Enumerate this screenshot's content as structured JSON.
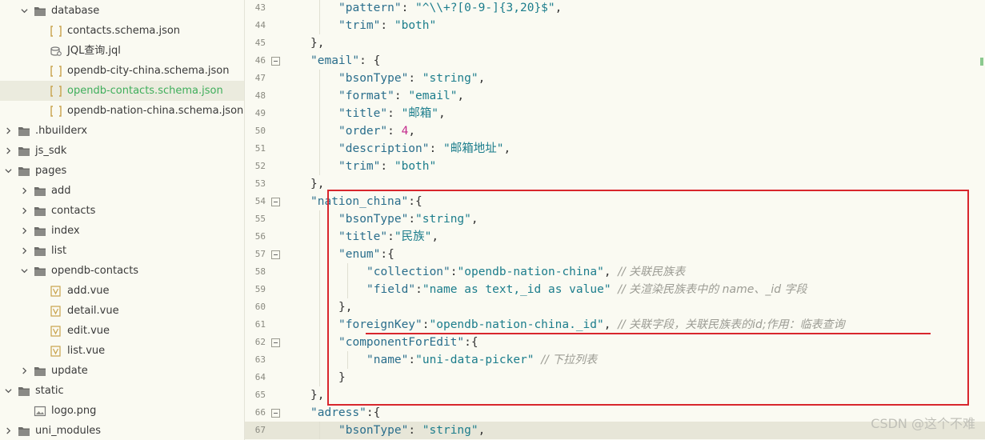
{
  "sidebar": {
    "items": [
      {
        "label": "database",
        "type": "folder",
        "indent": 1,
        "expanded": true
      },
      {
        "label": "contacts.schema.json",
        "type": "json",
        "indent": 2
      },
      {
        "label": "JQL查询.jql",
        "type": "jql",
        "indent": 2
      },
      {
        "label": "opendb-city-china.schema.json",
        "type": "json",
        "indent": 2
      },
      {
        "label": "opendb-contacts.schema.json",
        "type": "json",
        "indent": 2,
        "selected": true
      },
      {
        "label": "opendb-nation-china.schema.json",
        "type": "json",
        "indent": 2
      },
      {
        "label": ".hbuilderx",
        "type": "folder",
        "indent": 0,
        "expanded": false
      },
      {
        "label": "js_sdk",
        "type": "folder",
        "indent": 0,
        "expanded": false
      },
      {
        "label": "pages",
        "type": "folder",
        "indent": 0,
        "expanded": true
      },
      {
        "label": "add",
        "type": "folder",
        "indent": 1,
        "expanded": false
      },
      {
        "label": "contacts",
        "type": "folder",
        "indent": 1,
        "expanded": false
      },
      {
        "label": "index",
        "type": "folder",
        "indent": 1,
        "expanded": false
      },
      {
        "label": "list",
        "type": "folder",
        "indent": 1,
        "expanded": false
      },
      {
        "label": "opendb-contacts",
        "type": "folder",
        "indent": 1,
        "expanded": true
      },
      {
        "label": "add.vue",
        "type": "vue",
        "indent": 2
      },
      {
        "label": "detail.vue",
        "type": "vue",
        "indent": 2
      },
      {
        "label": "edit.vue",
        "type": "vue",
        "indent": 2
      },
      {
        "label": "list.vue",
        "type": "vue",
        "indent": 2
      },
      {
        "label": "update",
        "type": "folder",
        "indent": 1,
        "expanded": false
      },
      {
        "label": "static",
        "type": "folder",
        "indent": 0,
        "expanded": true
      },
      {
        "label": "logo.png",
        "type": "image",
        "indent": 1
      },
      {
        "label": "uni_modules",
        "type": "folder",
        "indent": 0,
        "expanded": false
      }
    ]
  },
  "editor": {
    "lines": [
      {
        "n": "43",
        "indent": 2,
        "tokens": [
          [
            "k",
            "\"pattern\""
          ],
          [
            "p",
            ": "
          ],
          [
            "s",
            "\"^\\\\+?[0-9-]{3,20}$\""
          ],
          [
            "p",
            ","
          ]
        ]
      },
      {
        "n": "44",
        "indent": 2,
        "tokens": [
          [
            "k",
            "\"trim\""
          ],
          [
            "p",
            ": "
          ],
          [
            "s",
            "\"both\""
          ]
        ]
      },
      {
        "n": "45",
        "indent": 1,
        "tokens": [
          [
            "p",
            "},"
          ]
        ]
      },
      {
        "n": "46",
        "indent": 1,
        "fold": true,
        "tokens": [
          [
            "k",
            "\"email\""
          ],
          [
            "p",
            ": {"
          ]
        ]
      },
      {
        "n": "47",
        "indent": 2,
        "tokens": [
          [
            "k",
            "\"bsonType\""
          ],
          [
            "p",
            ": "
          ],
          [
            "s",
            "\"string\""
          ],
          [
            "p",
            ","
          ]
        ]
      },
      {
        "n": "48",
        "indent": 2,
        "tokens": [
          [
            "k",
            "\"format\""
          ],
          [
            "p",
            ": "
          ],
          [
            "s",
            "\"email\""
          ],
          [
            "p",
            ","
          ]
        ]
      },
      {
        "n": "49",
        "indent": 2,
        "tokens": [
          [
            "k",
            "\"title\""
          ],
          [
            "p",
            ": "
          ],
          [
            "s",
            "\"邮箱\""
          ],
          [
            "p",
            ","
          ]
        ]
      },
      {
        "n": "50",
        "indent": 2,
        "tokens": [
          [
            "k",
            "\"order\""
          ],
          [
            "p",
            ": "
          ],
          [
            "n",
            "4"
          ],
          [
            "p",
            ","
          ]
        ]
      },
      {
        "n": "51",
        "indent": 2,
        "tokens": [
          [
            "k",
            "\"description\""
          ],
          [
            "p",
            ": "
          ],
          [
            "s",
            "\"邮箱地址\""
          ],
          [
            "p",
            ","
          ]
        ]
      },
      {
        "n": "52",
        "indent": 2,
        "tokens": [
          [
            "k",
            "\"trim\""
          ],
          [
            "p",
            ": "
          ],
          [
            "s",
            "\"both\""
          ]
        ]
      },
      {
        "n": "53",
        "indent": 1,
        "tokens": [
          [
            "p",
            "},"
          ]
        ]
      },
      {
        "n": "54",
        "indent": 1,
        "fold": true,
        "tokens": [
          [
            "k",
            "\"nation_china\""
          ],
          [
            "p",
            ":{"
          ]
        ]
      },
      {
        "n": "55",
        "indent": 2,
        "tokens": [
          [
            "k",
            "\"bsonType\""
          ],
          [
            "p",
            ":"
          ],
          [
            "s",
            "\"string\""
          ],
          [
            "p",
            ","
          ]
        ]
      },
      {
        "n": "56",
        "indent": 2,
        "tokens": [
          [
            "k",
            "\"title\""
          ],
          [
            "p",
            ":"
          ],
          [
            "s",
            "\"民族\""
          ],
          [
            "p",
            ","
          ]
        ]
      },
      {
        "n": "57",
        "indent": 2,
        "fold": true,
        "tokens": [
          [
            "k",
            "\"enum\""
          ],
          [
            "p",
            ":{"
          ]
        ]
      },
      {
        "n": "58",
        "indent": 3,
        "tokens": [
          [
            "k",
            "\"collection\""
          ],
          [
            "p",
            ":"
          ],
          [
            "s",
            "\"opendb-nation-china\""
          ],
          [
            "p",
            ", "
          ],
          [
            "c",
            "// 关联民族表"
          ]
        ]
      },
      {
        "n": "59",
        "indent": 3,
        "tokens": [
          [
            "k",
            "\"field\""
          ],
          [
            "p",
            ":"
          ],
          [
            "s",
            "\"name as text,_id as value\""
          ],
          [
            "p",
            " "
          ],
          [
            "c",
            "// 关渲染民族表中的 name、_id 字段"
          ]
        ]
      },
      {
        "n": "60",
        "indent": 2,
        "tokens": [
          [
            "p",
            "},"
          ]
        ]
      },
      {
        "n": "61",
        "indent": 2,
        "tokens": [
          [
            "k",
            "\"foreignKey\""
          ],
          [
            "p",
            ":"
          ],
          [
            "s",
            "\"opendb-nation-china._id\""
          ],
          [
            "p",
            ", "
          ],
          [
            "c",
            "// 关联字段，关联民族表的id;作用：临表查询"
          ]
        ]
      },
      {
        "n": "62",
        "indent": 2,
        "fold": true,
        "tokens": [
          [
            "k",
            "\"componentForEdit\""
          ],
          [
            "p",
            ":{"
          ]
        ]
      },
      {
        "n": "63",
        "indent": 3,
        "tokens": [
          [
            "k",
            "\"name\""
          ],
          [
            "p",
            ":"
          ],
          [
            "s",
            "\"uni-data-picker\""
          ],
          [
            "p",
            " "
          ],
          [
            "c",
            "// 下拉列表"
          ]
        ]
      },
      {
        "n": "64",
        "indent": 2,
        "tokens": [
          [
            "p",
            "}"
          ]
        ]
      },
      {
        "n": "65",
        "indent": 1,
        "tokens": [
          [
            "p",
            "},"
          ]
        ]
      },
      {
        "n": "66",
        "indent": 1,
        "fold": true,
        "tokens": [
          [
            "k",
            "\"adress\""
          ],
          [
            "p",
            ":{"
          ]
        ]
      },
      {
        "n": "67",
        "indent": 2,
        "current": true,
        "tokens": [
          [
            "k",
            "\"bsonType\""
          ],
          [
            "p",
            ": "
          ],
          [
            "s",
            "\"string\""
          ],
          [
            "p",
            ","
          ]
        ]
      }
    ]
  },
  "watermark": "CSDN @这个不难",
  "colors": {
    "accent": "#3fae5b",
    "highlight": "#d8262d",
    "key": "#2a6e8c",
    "string": "#1c7d8c",
    "number": "#c32a8c",
    "comment": "#9c9c94"
  }
}
